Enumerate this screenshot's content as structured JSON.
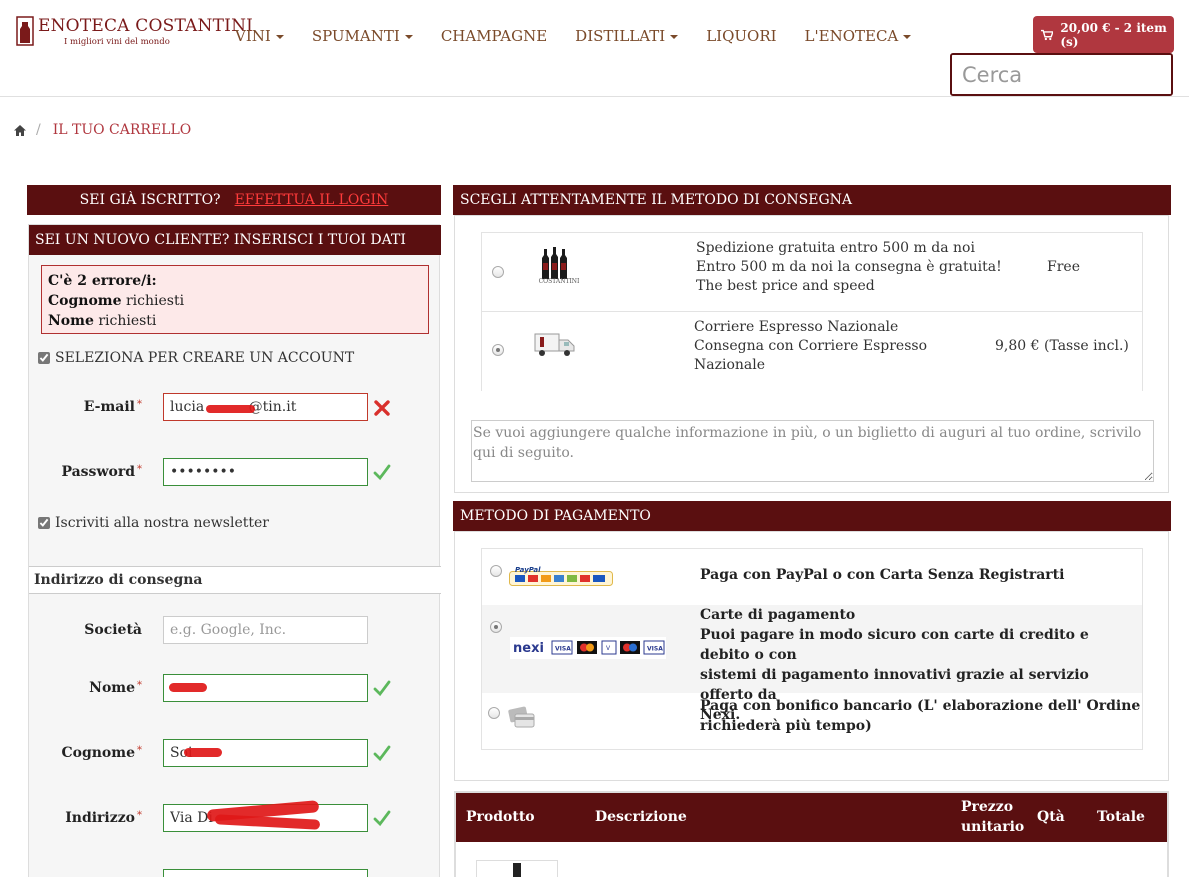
{
  "header": {
    "logo_title": "ENOTECA COSTANTINI",
    "logo_subtitle": "I migliori vini del mondo",
    "nav": [
      {
        "label": "VINI",
        "dropdown": true
      },
      {
        "label": "SPUMANTI",
        "dropdown": true
      },
      {
        "label": "CHAMPAGNE",
        "dropdown": false
      },
      {
        "label": "DISTILLATI",
        "dropdown": true
      },
      {
        "label": "LIQUORI",
        "dropdown": false
      },
      {
        "label": "L'ENOTECA",
        "dropdown": true
      }
    ],
    "cart_label": "20,00 € - 2 item (s)",
    "search_placeholder": "Cerca"
  },
  "breadcrumb": {
    "separator": "/",
    "current": "IL TUO CARRELLO"
  },
  "login": {
    "question": "SEI GIÀ ISCRITTO?",
    "link": "EFFETTUA IL LOGIN"
  },
  "new_customer": {
    "title": "SEI UN NUOVO CLIENTE? INSERISCI I TUOI DATI",
    "error_title": "C'è 2 errore/i:",
    "errors": [
      {
        "field": "Cognome",
        "message": "richiesti"
      },
      {
        "field": "Nome",
        "message": "richiesti"
      }
    ],
    "create_account_label": "SELEZIONA PER CREARE UN ACCOUNT",
    "email_label": "E-mail",
    "email_value": "lucia          @tin.it",
    "password_label": "Password",
    "password_value": "••••••••",
    "newsletter_label": "Iscriviti alla nostra newsletter",
    "address_section": "Indirizzo di consegna",
    "company_label": "Società",
    "company_placeholder": "e.g. Google, Inc.",
    "name_label": "Nome",
    "surname_label": "Cognome",
    "surname_value": "Soi",
    "address_label": "Indirizzo",
    "address_value": "Via Di",
    "required_mark": "*"
  },
  "delivery": {
    "title": "SCEGLI ATTENTAMENTE IL METODO DI CONSEGNA",
    "options": [
      {
        "lines": [
          "Spedizione gratuita entro 500 m da noi",
          "Entro 500 m da noi la consegna è gratuita!",
          "The best price and speed"
        ],
        "price": "Free",
        "selected": false,
        "icon": "wine-bottles-icon",
        "logo_text": "COSTANTINI"
      },
      {
        "lines": [
          "Corriere Espresso Nazionale",
          "Consegna con Corriere Espresso",
          "Nazionale"
        ],
        "price": "9,80 € (Tasse incl.)",
        "selected": true,
        "icon": "delivery-truck-icon"
      }
    ],
    "notes_placeholder": "Se vuoi aggiungere qualche informazione in più, o un biglietto di auguri al tuo ordine, scrivilo qui di seguito."
  },
  "payment": {
    "title": "METODO DI PAGAMENTO",
    "options": [
      {
        "lines": [
          "Paga con PayPal o con Carta Senza Registrarti"
        ],
        "selected": false,
        "icon": "paypal-icon"
      },
      {
        "lines": [
          "Carte di pagamento",
          "Puoi pagare in modo sicuro con carte di credito e debito o con",
          "sistemi di pagamento innovativi grazie al servizio offerto da",
          "Nexi."
        ],
        "selected": true,
        "icon": "nexi-cards-icon"
      },
      {
        "lines": [
          "Paga con bonifico bancario (L' elaborazione dell' Ordine",
          "richiederà più tempo)"
        ],
        "selected": false,
        "icon": "bank-card-icon"
      }
    ]
  },
  "products_table": {
    "columns": [
      "Prodotto",
      "Descrizione",
      "Prezzo",
      "unitario",
      "Qtà",
      "Totale"
    ]
  },
  "colors": {
    "brand_dark": "#5a0f10",
    "cart_red": "#b0373f",
    "error_red": "#c0392b",
    "valid_green": "#3a8f3a"
  }
}
